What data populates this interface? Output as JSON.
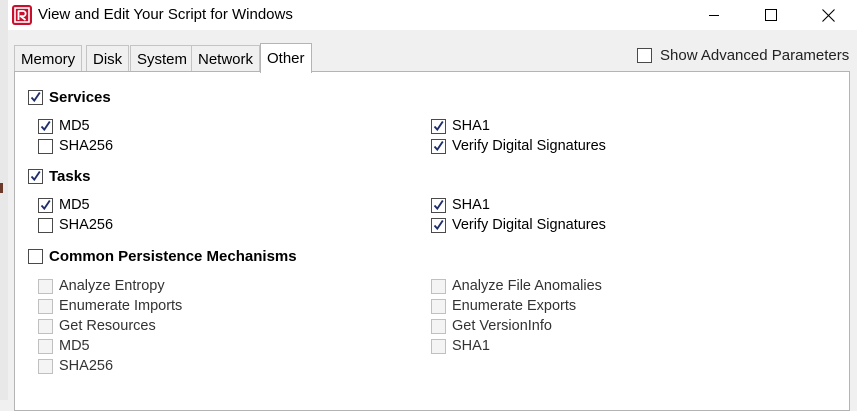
{
  "window": {
    "title": "View and Edit Your Script for Windows"
  },
  "tabs": [
    {
      "label": "Memory",
      "active": false
    },
    {
      "label": "Disk",
      "active": false
    },
    {
      "label": "System",
      "active": false
    },
    {
      "label": "Network",
      "active": false
    },
    {
      "label": "Other",
      "active": true
    }
  ],
  "advanced": {
    "label": "Show Advanced Parameters",
    "checked": false
  },
  "services": {
    "label": "Services",
    "checked": true,
    "md5": {
      "label": "MD5",
      "checked": true
    },
    "sha256": {
      "label": "SHA256",
      "checked": false
    },
    "sha1": {
      "label": "SHA1",
      "checked": true
    },
    "verify_sigs": {
      "label": "Verify Digital Signatures",
      "checked": true
    }
  },
  "tasks": {
    "label": "Tasks",
    "checked": true,
    "md5": {
      "label": "MD5",
      "checked": true
    },
    "sha256": {
      "label": "SHA256",
      "checked": false
    },
    "sha1": {
      "label": "SHA1",
      "checked": true
    },
    "verify_sigs": {
      "label": "Verify Digital Signatures",
      "checked": true
    }
  },
  "persistence": {
    "label": "Common Persistence Mechanisms",
    "checked": false,
    "analyze_entropy": {
      "label": "Analyze Entropy",
      "checked": false
    },
    "enumerate_imports": {
      "label": "Enumerate Imports",
      "checked": false
    },
    "get_resources": {
      "label": "Get Resources",
      "checked": false
    },
    "md5": {
      "label": "MD5",
      "checked": false
    },
    "sha256": {
      "label": "SHA256",
      "checked": false
    },
    "analyze_file_anomalies": {
      "label": "Analyze File Anomalies",
      "checked": false
    },
    "enumerate_exports": {
      "label": "Enumerate Exports",
      "checked": false
    },
    "get_versioninfo": {
      "label": "Get VersionInfo",
      "checked": false
    },
    "sha1": {
      "label": "SHA1",
      "checked": false
    }
  },
  "colors": {
    "accent": "#c8102e",
    "check": "#1f2d6b"
  }
}
